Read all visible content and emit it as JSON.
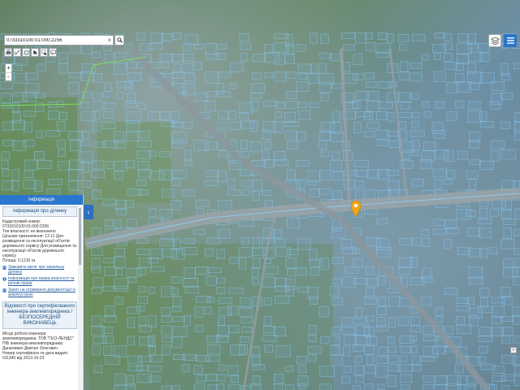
{
  "search": {
    "value": "0733310100:01:000:2256",
    "clear_symbol": "×"
  },
  "toolbar": {
    "tools": [
      "print-icon",
      "ruler-icon",
      "measure-area-icon",
      "pointer-icon",
      "info-select-icon",
      "comment-icon"
    ]
  },
  "zoom": {
    "in_label": "+",
    "out_label": "-"
  },
  "panel": {
    "header": "Інформація",
    "collapse_symbol": "‹",
    "parcel_section_title": "Інформація про ділянку",
    "cadastral_label": "Кадастровий номер:",
    "cadastral_value": "0733310100:01:000:2256",
    "ownership_type": "Тип власності: не визначено",
    "purpose_line1": "Цільове призначення: 12.11 Для",
    "purpose_line2": "розміщення та експлуатації об'єктів",
    "purpose_line3": "дорожнього сервісу Для розміщення та",
    "purpose_line4": "експлуатації об'єктів дорожнього",
    "purpose_line5": "сервісу",
    "area": "Площа: 0.1216 га",
    "link_extract_1": "Замовити витяг про земельну",
    "link_extract_2": "ділянку",
    "link_rights_1": "Інформація про права власності та",
    "link_rights_2": "речові права",
    "link_docs_1": "Запит на отримання документації із",
    "link_docs_2": "землеустрою",
    "engineer_section_title": "Відомості про сертифікованого інженера-землевпорядника / БЕЗПОСЕРЕДНІЙ ВИКОНАВЕЦЬ",
    "engineer_workplace_1": "Місце роботи інженера",
    "engineer_workplace_2": "землевпорядника: ТОВ \"ГЕО-ЛЕНДС\"",
    "engineer_name_1": "ПІБ інженера-землевпорядника:",
    "engineer_name_2": "Данилевич Дмитро Олегович",
    "certificate": "Номер сертифіката та дата видачі:",
    "certificate_value": "011340 від 2013-10-23"
  },
  "corner_box_label": "+",
  "colors": {
    "accent": "#2a77cf",
    "parcel_outline": "#8fd3ff",
    "pin": "#f2a516"
  }
}
